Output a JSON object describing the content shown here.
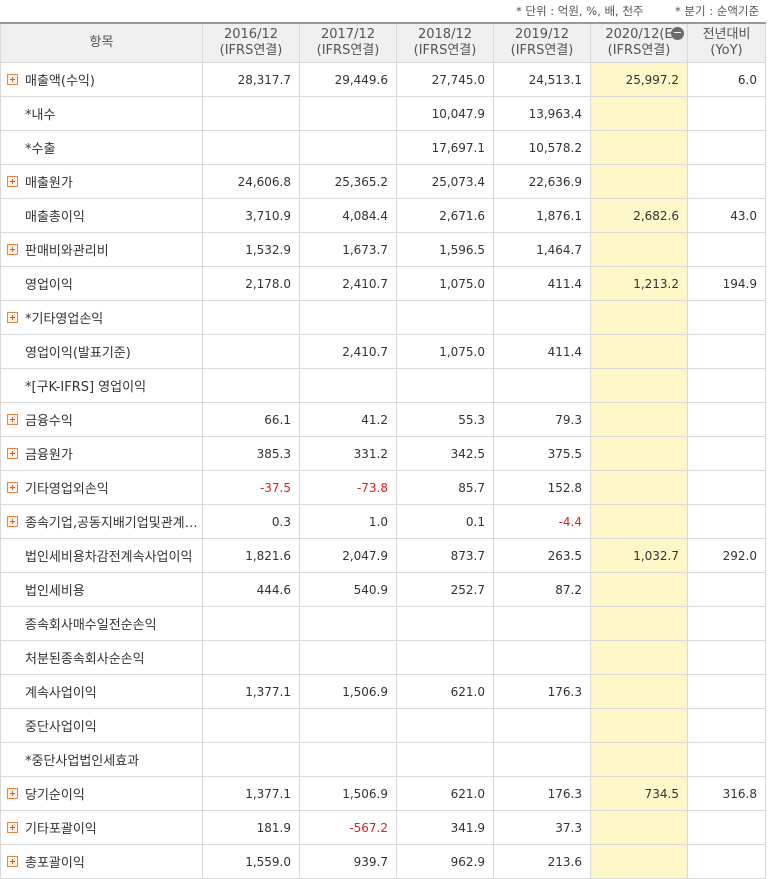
{
  "notes": {
    "unit": "* 단위 : 억원, %, 배, 천주",
    "quarter": "* 분기 : 순액기준"
  },
  "header": {
    "item": "항목",
    "columns": [
      {
        "period": "2016/12",
        "basis": "(IFRS연결)"
      },
      {
        "period": "2017/12",
        "basis": "(IFRS연결)"
      },
      {
        "period": "2018/12",
        "basis": "(IFRS연결)"
      },
      {
        "period": "2019/12",
        "basis": "(IFRS연결)"
      },
      {
        "period": "2020/12(E",
        "basis": "(IFRS연결)"
      },
      {
        "period": "전년대비",
        "basis": "(YoY)"
      }
    ]
  },
  "rows": [
    {
      "label": "매출액(수익)",
      "expand": true,
      "values": [
        "28,317.7",
        "29,449.6",
        "27,745.0",
        "24,513.1",
        "25,997.2",
        "6.0"
      ]
    },
    {
      "label": "*내수",
      "expand": false,
      "values": [
        "",
        "",
        "10,047.9",
        "13,963.4",
        "",
        ""
      ]
    },
    {
      "label": "*수출",
      "expand": false,
      "values": [
        "",
        "",
        "17,697.1",
        "10,578.2",
        "",
        ""
      ]
    },
    {
      "label": "매출원가",
      "expand": true,
      "values": [
        "24,606.8",
        "25,365.2",
        "25,073.4",
        "22,636.9",
        "",
        ""
      ]
    },
    {
      "label": "매출총이익",
      "expand": false,
      "values": [
        "3,710.9",
        "4,084.4",
        "2,671.6",
        "1,876.1",
        "2,682.6",
        "43.0"
      ]
    },
    {
      "label": "판매비와관리비",
      "expand": true,
      "values": [
        "1,532.9",
        "1,673.7",
        "1,596.5",
        "1,464.7",
        "",
        ""
      ]
    },
    {
      "label": "영업이익",
      "expand": false,
      "values": [
        "2,178.0",
        "2,410.7",
        "1,075.0",
        "411.4",
        "1,213.2",
        "194.9"
      ]
    },
    {
      "label": "*기타영업손익",
      "expand": true,
      "values": [
        "",
        "",
        "",
        "",
        "",
        ""
      ]
    },
    {
      "label": "영업이익(발표기준)",
      "expand": false,
      "values": [
        "",
        "2,410.7",
        "1,075.0",
        "411.4",
        "",
        ""
      ]
    },
    {
      "label": "*[구K-IFRS] 영업이익",
      "expand": false,
      "values": [
        "",
        "",
        "",
        "",
        "",
        ""
      ]
    },
    {
      "label": "금융수익",
      "expand": true,
      "values": [
        "66.1",
        "41.2",
        "55.3",
        "79.3",
        "",
        ""
      ]
    },
    {
      "label": "금융원가",
      "expand": true,
      "values": [
        "385.3",
        "331.2",
        "342.5",
        "375.5",
        "",
        ""
      ]
    },
    {
      "label": "기타영업외손익",
      "expand": true,
      "values": [
        "-37.5",
        "-73.8",
        "85.7",
        "152.8",
        "",
        ""
      ]
    },
    {
      "label": "종속기업,공동지배기업및관계기업관련손익",
      "expand": true,
      "values": [
        "0.3",
        "1.0",
        "0.1",
        "-4.4",
        "",
        ""
      ]
    },
    {
      "label": "법인세비용차감전계속사업이익",
      "expand": false,
      "values": [
        "1,821.6",
        "2,047.9",
        "873.7",
        "263.5",
        "1,032.7",
        "292.0"
      ]
    },
    {
      "label": "법인세비용",
      "expand": false,
      "values": [
        "444.6",
        "540.9",
        "252.7",
        "87.2",
        "",
        ""
      ]
    },
    {
      "label": "종속회사매수일전순손익",
      "expand": false,
      "values": [
        "",
        "",
        "",
        "",
        "",
        ""
      ]
    },
    {
      "label": "처분된종속회사순손익",
      "expand": false,
      "values": [
        "",
        "",
        "",
        "",
        "",
        ""
      ]
    },
    {
      "label": "계속사업이익",
      "expand": false,
      "values": [
        "1,377.1",
        "1,506.9",
        "621.0",
        "176.3",
        "",
        ""
      ]
    },
    {
      "label": "중단사업이익",
      "expand": false,
      "values": [
        "",
        "",
        "",
        "",
        "",
        ""
      ]
    },
    {
      "label": "*중단사업법인세효과",
      "expand": false,
      "values": [
        "",
        "",
        "",
        "",
        "",
        ""
      ]
    },
    {
      "label": "당기순이익",
      "expand": true,
      "values": [
        "1,377.1",
        "1,506.9",
        "621.0",
        "176.3",
        "734.5",
        "316.8"
      ]
    },
    {
      "label": "기타포괄이익",
      "expand": true,
      "values": [
        "181.9",
        "-567.2",
        "341.9",
        "37.3",
        "",
        ""
      ]
    },
    {
      "label": "총포괄이익",
      "expand": true,
      "values": [
        "1,559.0",
        "939.7",
        "962.9",
        "213.6",
        "",
        ""
      ]
    }
  ],
  "colors": {
    "highlight": "#fdf7c9",
    "negative": "#d62424",
    "expand_icon": "#e2531e"
  }
}
